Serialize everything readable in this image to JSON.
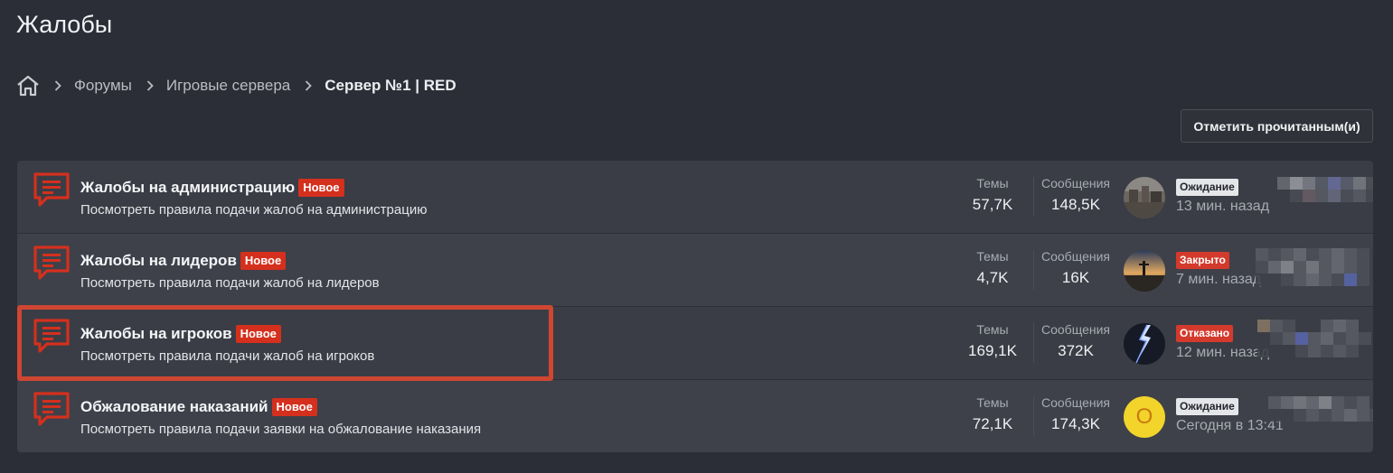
{
  "page": {
    "title": "Жалобы"
  },
  "breadcrumb": {
    "items": [
      "Форумы",
      "Игровые сервера"
    ],
    "current": "Сервер №1 | RED"
  },
  "actions": {
    "mark_read_label": "Отметить прочитанным(и)"
  },
  "labels": {
    "topics": "Темы",
    "posts": "Сообщения"
  },
  "colors": {
    "accent_red": "#d4301d",
    "background": "#2b2e36",
    "row": "#3a3d45"
  },
  "forums": [
    {
      "title": "Жалобы на администрацию",
      "badge": "Новое",
      "description": "Посмотреть правила подачи жалоб на администрацию",
      "topics": "57,7K",
      "posts": "148,5K",
      "status": "Ожидание",
      "last_time": "13 мин. назад",
      "avatar": "photo-city"
    },
    {
      "title": "Жалобы на лидеров",
      "badge": "Новое",
      "description": "Посмотреть правила подачи жалоб на лидеров",
      "topics": "4,7K",
      "posts": "16K",
      "status": "Закрыто",
      "last_time": "7 мин. назад",
      "avatar": "photo-sunset"
    },
    {
      "title": "Жалобы на игроков",
      "badge": "Новое",
      "description": "Посмотреть правила подачи жалоб на игроков",
      "topics": "169,1K",
      "posts": "372K",
      "status": "Отказано",
      "last_time": "12 мин. назад",
      "avatar": "photo-lightning"
    },
    {
      "title": "Обжалование наказаний",
      "badge": "Новое",
      "description": "Посмотреть правила подачи заявки на обжалование наказания",
      "topics": "72,1K",
      "posts": "174,3K",
      "status": "Ожидание",
      "last_time": "Сегодня в 13:41",
      "avatar": "О"
    }
  ]
}
